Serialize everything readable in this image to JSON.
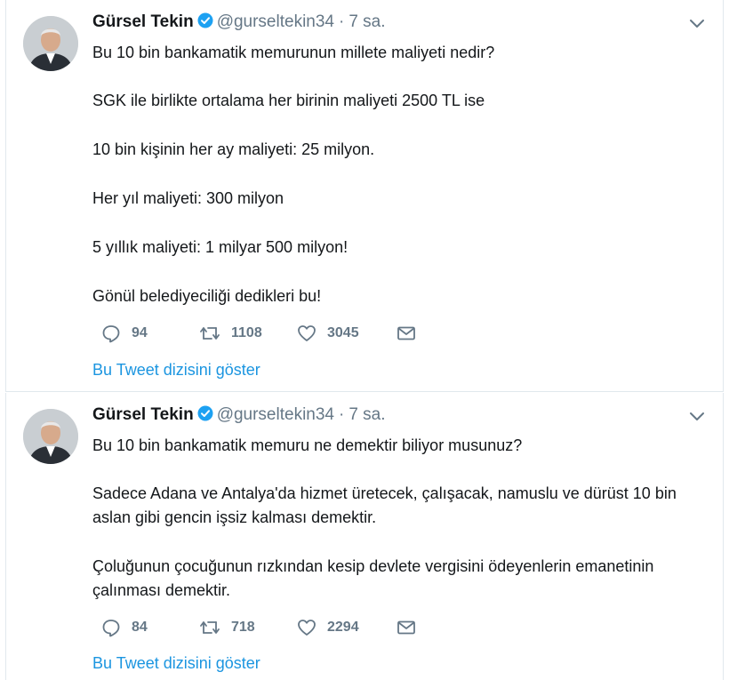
{
  "tweets": [
    {
      "author": {
        "name": "Gürsel Tekin",
        "handle": "@gurseltekin34"
      },
      "time": "7 sa.",
      "separator": "·",
      "lines": [
        "Bu 10 bin bankamatik memurunun millete maliyeti nedir?",
        "SGK ile birlikte ortalama her birinin maliyeti 2500 TL ise",
        "10 bin kişinin her ay maliyeti: 25 milyon.",
        "Her yıl maliyeti: 300 milyon",
        "5 yıllık maliyeti: 1 milyar 500 milyon!",
        "Gönül belediyeciliği dedikleri bu!"
      ],
      "replies": "94",
      "retweets": "1108",
      "likes": "3045",
      "show_thread": "Bu Tweet dizisini göster"
    },
    {
      "author": {
        "name": "Gürsel Tekin",
        "handle": "@gurseltekin34"
      },
      "time": "7 sa.",
      "separator": "·",
      "lines": [
        "Bu 10 bin bankamatik memuru ne demektir biliyor musunuz?",
        "Sadece Adana ve Antalya'da hizmet üretecek, çalışacak, namuslu ve dürüst 10 bin",
        "aslan gibi gencin işsiz kalması demektir.",
        "Çoluğunun çocuğunun rızkından kesip devlete vergisini ödeyenlerin emanetinin",
        "çalınması demektir."
      ],
      "replies": "84",
      "retweets": "718",
      "likes": "2294",
      "show_thread": "Bu Tweet dizisini göster"
    }
  ],
  "icons": {
    "verified": "verified-badge-icon",
    "menu": "chevron-down-icon",
    "reply": "reply-icon",
    "retweet": "retweet-icon",
    "like": "heart-icon",
    "dm": "envelope-icon"
  },
  "colors": {
    "link": "#1b95e0",
    "muted": "#657786",
    "verified": "#1da1f2",
    "text": "#14171a"
  }
}
